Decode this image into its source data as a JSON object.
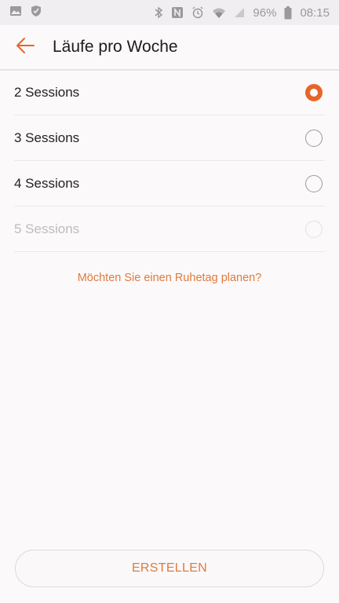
{
  "status_bar": {
    "battery": "96%",
    "time": "08:15",
    "left_icons": [
      "image-icon",
      "shield-icon"
    ],
    "right_icons": [
      "bluetooth-icon",
      "nfc-icon",
      "alarm-icon",
      "wifi-icon",
      "signal-icon",
      "battery-icon"
    ]
  },
  "header": {
    "back_icon": "arrow-left-icon",
    "title": "Läufe pro Woche"
  },
  "options": [
    {
      "label": "2 Sessions",
      "selected": true,
      "enabled": true
    },
    {
      "label": "3 Sessions",
      "selected": false,
      "enabled": true
    },
    {
      "label": "4 Sessions",
      "selected": false,
      "enabled": true
    },
    {
      "label": "5 Sessions",
      "selected": false,
      "enabled": false
    }
  ],
  "rest_day_link": "Möchten Sie einen Ruhetag planen?",
  "create_button": "ERSTELLEN",
  "colors": {
    "accent": "#e8652a",
    "link": "#e07a3e",
    "disabled_text": "#bdbdbd",
    "background": "#fbf9fa"
  }
}
